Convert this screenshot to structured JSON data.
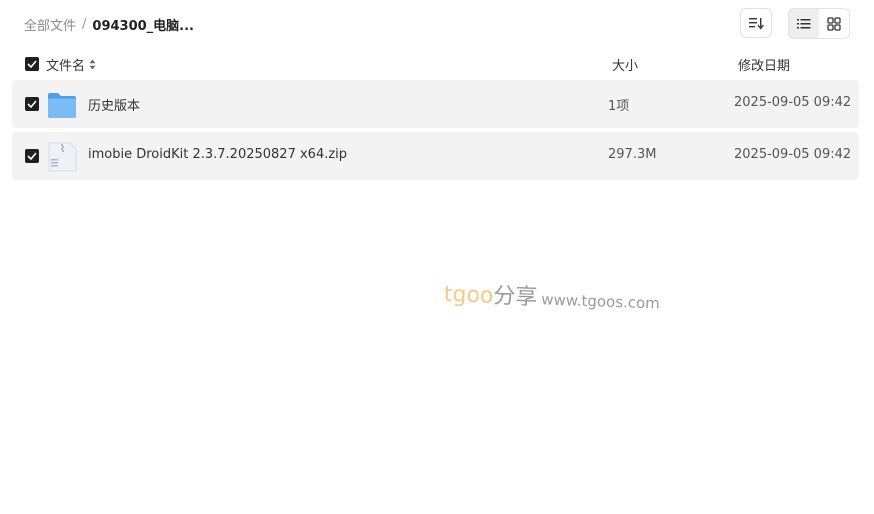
{
  "breadcrumb": {
    "root": "全部文件",
    "separator": "/",
    "current": "094300_电脑..."
  },
  "toolbar": {
    "sort_icon": "sort-order-icon",
    "views": [
      {
        "icon": "list-view-icon",
        "active": true
      },
      {
        "icon": "grid-view-icon",
        "active": false
      }
    ]
  },
  "header": {
    "name": "文件名",
    "size": "大小",
    "date": "修改日期",
    "all_selected": true
  },
  "files": [
    {
      "icon": "folder-icon",
      "name": "历史版本",
      "size": "1项",
      "date": "2025-09-05 09:42",
      "selected": true
    },
    {
      "icon": "zip-file-icon",
      "name": "imobie DroidKit 2.3.7.20250827 x64.zip",
      "size": "297.3M",
      "date": "2025-09-05 09:42",
      "selected": true
    }
  ],
  "watermark": {
    "brand": "tgoo",
    "share": "分享",
    "url": "www.tgoos.com"
  },
  "colors": {
    "row_bg": "#f3f3f3",
    "checkbox": "#1f1f1f",
    "folder": "#5aa7ef",
    "watermark_brand": "#f5c98a"
  }
}
